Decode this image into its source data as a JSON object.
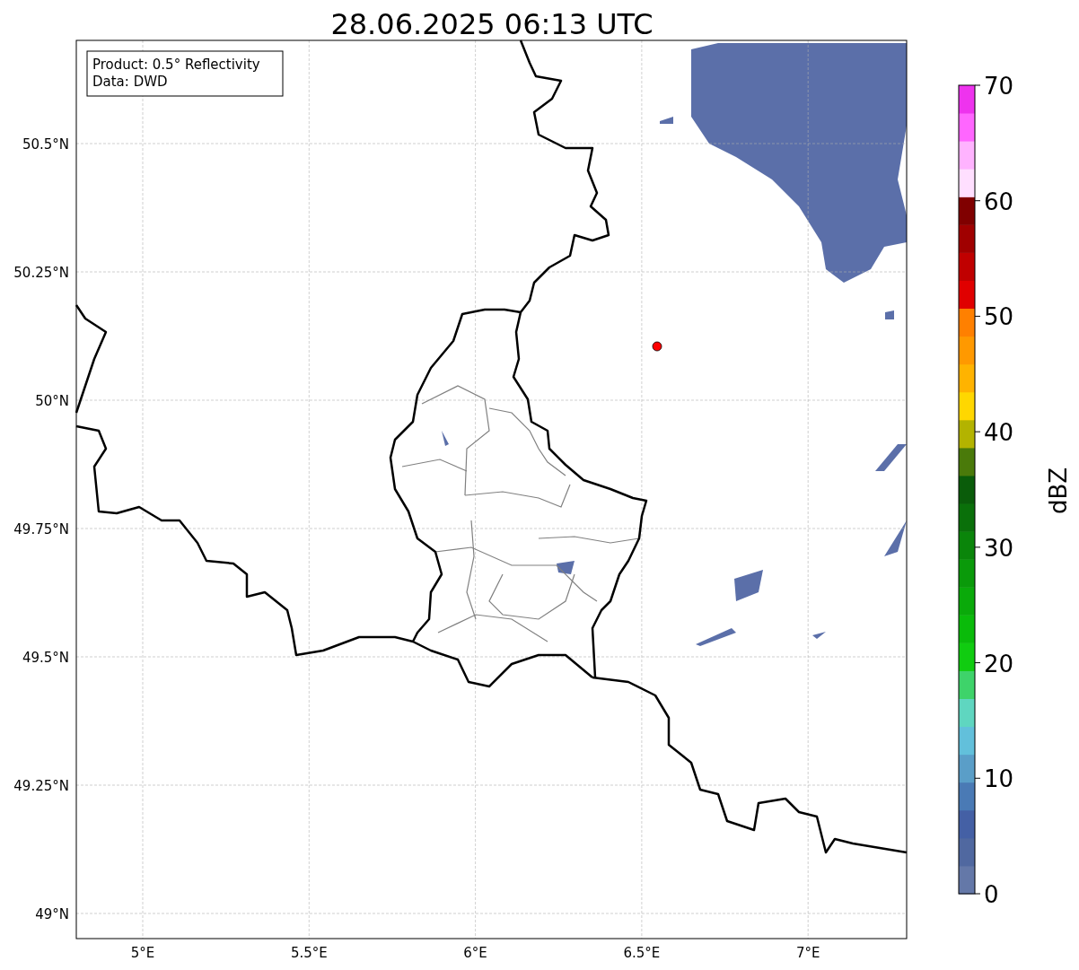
{
  "title": "28.06.2025 06:13 UTC",
  "info_box": {
    "lines": [
      "Product: 0.5° Reflectivity",
      "Data: DWD"
    ]
  },
  "x_ticks": [
    "5°E",
    "5.5°E",
    "6°E",
    "6.5°E",
    "7°E"
  ],
  "y_ticks": [
    "50.5°N",
    "50.25°N",
    "50°N",
    "49.75°N",
    "49.5°N",
    "49.25°N",
    "49°N"
  ],
  "colorbar": {
    "label": "dBZ",
    "ticks": [
      "70",
      "60",
      "50",
      "40",
      "30",
      "20",
      "10",
      "0"
    ],
    "bands": [
      {
        "color": "#6478a8"
      },
      {
        "color": "#5068a0"
      },
      {
        "color": "#4460a5"
      },
      {
        "color": "#4a7ab5"
      },
      {
        "color": "#5a9ec8"
      },
      {
        "color": "#62c0db"
      },
      {
        "color": "#5fd6c0"
      },
      {
        "color": "#3ed36a"
      },
      {
        "color": "#10cc10"
      },
      {
        "color": "#0abb0a"
      },
      {
        "color": "#0aaa0a"
      },
      {
        "color": "#0a9a0a"
      },
      {
        "color": "#0a850a"
      },
      {
        "color": "#0a700a"
      },
      {
        "color": "#0a5c0a"
      },
      {
        "color": "#4a7a0a"
      },
      {
        "color": "#b3b300"
      },
      {
        "color": "#ffd700"
      },
      {
        "color": "#ffb300"
      },
      {
        "color": "#ff9900"
      },
      {
        "color": "#ff8000"
      },
      {
        "color": "#e00000"
      },
      {
        "color": "#c00000"
      },
      {
        "color": "#a00000"
      },
      {
        "color": "#800000"
      },
      {
        "color": "#ffdfff"
      },
      {
        "color": "#ffb3ff"
      },
      {
        "color": "#ff66ff"
      },
      {
        "color": "#ee33ee"
      }
    ]
  }
}
